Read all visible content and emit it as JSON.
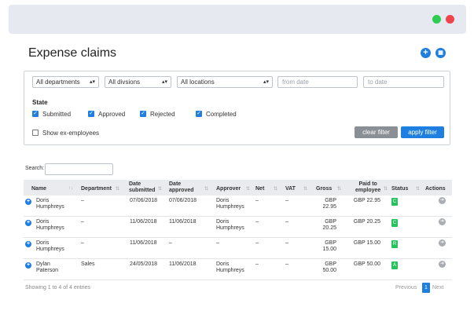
{
  "page": {
    "title": "Expense claims"
  },
  "filters": {
    "department": "All departments",
    "division": "All divsions",
    "location": "All locations",
    "from_date_placeholder": "from date",
    "to_date_placeholder": "to date",
    "state_label": "State",
    "states": [
      {
        "label": "Submitted",
        "checked": true
      },
      {
        "label": "Approved",
        "checked": true
      },
      {
        "label": "Rejected",
        "checked": true
      },
      {
        "label": "Completed",
        "checked": true
      }
    ],
    "ex_employees_label": "Show ex-employees",
    "clear_label": "clear filter",
    "apply_label": "apply filter"
  },
  "search": {
    "label": "Search:"
  },
  "table": {
    "headers": {
      "name": "Name",
      "department": "Department",
      "date_submitted": [
        "Date",
        "submitted"
      ],
      "date_approved": [
        "Date",
        "approved"
      ],
      "approver": "Approver",
      "net": "Net",
      "vat": "VAT",
      "gross": "Gross",
      "paid": [
        "Paid to",
        "employee"
      ],
      "status": "Status",
      "actions": "Actions"
    },
    "rows": [
      {
        "name": [
          "Doris",
          "Humphreys"
        ],
        "department": "–",
        "submitted": "07/06/2018",
        "approved": "07/06/2018",
        "approver": [
          "Doris",
          "Humphreys"
        ],
        "net": "–",
        "vat": "–",
        "gross": [
          "GBP",
          "22.95"
        ],
        "paid": "GBP 22.95",
        "status": "C"
      },
      {
        "name": [
          "Doris",
          "Humphreys"
        ],
        "department": "–",
        "submitted": "11/06/2018",
        "approved": "11/06/2018",
        "approver": [
          "Doris",
          "Humphreys"
        ],
        "net": "–",
        "vat": "–",
        "gross": [
          "GBP",
          "20.25"
        ],
        "paid": "GBP 20.25",
        "status": "C"
      },
      {
        "name": [
          "Doris",
          "Humphreys"
        ],
        "department": "–",
        "submitted": "11/06/2018",
        "approved": "–",
        "approver": [
          "–",
          ""
        ],
        "net": "–",
        "vat": "–",
        "gross": [
          "GBP",
          "15.00"
        ],
        "paid": "GBP 15.00",
        "status": "R"
      },
      {
        "name": [
          "Dylan",
          "Paterson"
        ],
        "department": "Sales",
        "submitted": "24/05/2018",
        "approved": "11/06/2018",
        "approver": [
          "Doris",
          "Humphreys"
        ],
        "net": "–",
        "vat": "–",
        "gross": [
          "GBP",
          "50.00"
        ],
        "paid": "GBP 50.00",
        "status": "A"
      }
    ]
  },
  "footer": {
    "info": "Showing 1 to 4 of 4 entries",
    "previous": "Previous",
    "page": "1",
    "next": "Next"
  }
}
